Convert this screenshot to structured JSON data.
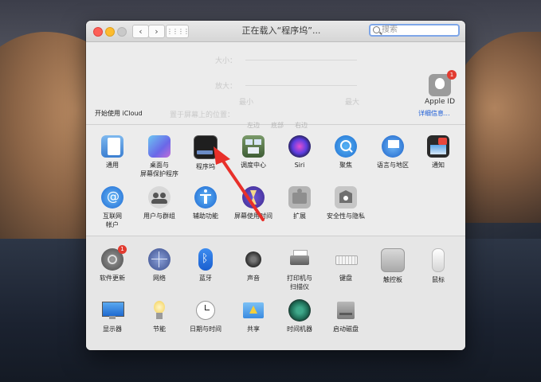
{
  "window": {
    "title": "正在载入“程序坞”...",
    "search_placeholder": "搜索",
    "back_label": "‹",
    "forward_label": "›",
    "grid_label": "⋮⋮⋮⋮"
  },
  "account": {
    "apple_id_label": "Apple ID",
    "apple_id_badge": "1",
    "icloud_title": "开始使用 iCloud",
    "icloud_link": "详细信息..."
  },
  "ghost": {
    "size": "大小：",
    "magnify": "放大：",
    "small": "小",
    "large": "大",
    "min": "最小",
    "max": "最大",
    "position": "置于屏幕上的位置：",
    "left": "左边",
    "bottom": "底部",
    "right": "右边"
  },
  "panes_row1": [
    {
      "label": "通用",
      "icon": "general-icon"
    },
    {
      "label": "桌面与\n屏幕保护程序",
      "icon": "desktop-icon"
    },
    {
      "label": "程序坞",
      "icon": "dock-icon"
    },
    {
      "label": "调度中心",
      "icon": "mission-control-icon"
    },
    {
      "label": "Siri",
      "icon": "siri-icon"
    },
    {
      "label": "聚焦",
      "icon": "spotlight-icon"
    },
    {
      "label": "语言与地区",
      "icon": "language-icon"
    },
    {
      "label": "通知",
      "icon": "notifications-icon"
    }
  ],
  "panes_row2": [
    {
      "label": "互联网\n帐户",
      "icon": "internet-accounts-icon"
    },
    {
      "label": "用户与群组",
      "icon": "users-icon"
    },
    {
      "label": "辅助功能",
      "icon": "accessibility-icon"
    },
    {
      "label": "屏幕使用时间",
      "icon": "screen-time-icon"
    },
    {
      "label": "扩展",
      "icon": "extensions-icon"
    },
    {
      "label": "安全性与隐私",
      "icon": "security-icon"
    }
  ],
  "panes_row3": [
    {
      "label": "软件更新",
      "icon": "software-update-icon",
      "badge": "1"
    },
    {
      "label": "网络",
      "icon": "network-icon"
    },
    {
      "label": "蓝牙",
      "icon": "bluetooth-icon"
    },
    {
      "label": "声音",
      "icon": "sound-icon"
    },
    {
      "label": "打印机与\n扫描仪",
      "icon": "printers-icon"
    },
    {
      "label": "键盘",
      "icon": "keyboard-icon"
    },
    {
      "label": "触控板",
      "icon": "trackpad-icon"
    },
    {
      "label": "鼠标",
      "icon": "mouse-icon"
    }
  ],
  "panes_row4": [
    {
      "label": "显示器",
      "icon": "displays-icon"
    },
    {
      "label": "节能",
      "icon": "energy-saver-icon"
    },
    {
      "label": "日期与时间",
      "icon": "date-time-icon"
    },
    {
      "label": "共享",
      "icon": "sharing-icon"
    },
    {
      "label": "时间机器",
      "icon": "time-machine-icon"
    },
    {
      "label": "启动磁盘",
      "icon": "startup-disk-icon"
    }
  ],
  "colors": {
    "accent": "#1a5bd6",
    "arrow": "#e8302a",
    "badge": "#e23b30"
  }
}
